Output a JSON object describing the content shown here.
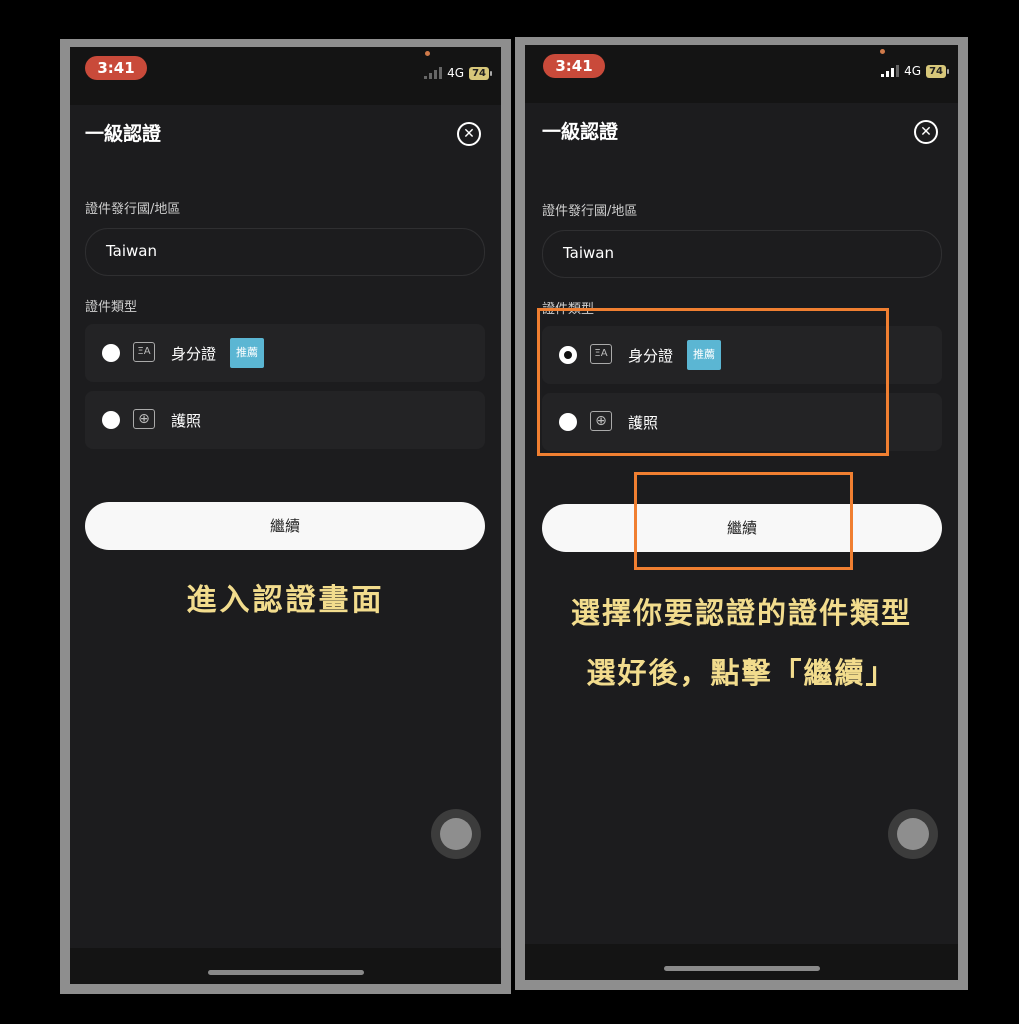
{
  "status": {
    "time": "3:41",
    "network": "4G",
    "battery": "74"
  },
  "screen": {
    "title": "一級認證",
    "close_icon": "✕",
    "country_label": "證件發行國/地區",
    "country_value": "Taiwan",
    "doctype_label": "證件類型",
    "options": [
      {
        "label": "身分證",
        "badge": "推薦",
        "icon": "id-card-icon",
        "icon_glyph": "ΞA"
      },
      {
        "label": "護照",
        "icon": "passport-icon",
        "icon_glyph": "⊕"
      }
    ],
    "continue_label": "繼續"
  },
  "left": {
    "caption": "進入認證畫面",
    "selected_option": null
  },
  "right": {
    "caption_line1": "選擇你要認證的證件類型",
    "caption_line2": "選好後，點擊「繼續」",
    "selected_option": 0
  },
  "colors": {
    "caption": "#f2dc8d",
    "highlight": "#f07f31",
    "badge": "#5bb6d3",
    "time_pill": "#c94a3a"
  }
}
